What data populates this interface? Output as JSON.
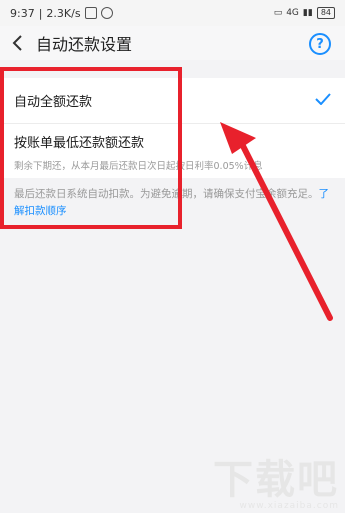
{
  "status_bar": {
    "time": "9:37",
    "speed": "2.3K/s",
    "signal_text": "4G",
    "battery": "84"
  },
  "header": {
    "title": "自动还款设置",
    "help_label": "?"
  },
  "options": [
    {
      "label": "自动全额还款",
      "selected": true
    },
    {
      "label": "按账单最低还款额还款",
      "subtitle": "剩余下期还，从本月最后还款日次日起按日利率0.05%计息",
      "selected": false
    }
  ],
  "note": {
    "text": "最后还款日系统自动扣款。为避免逾期，请确保支付宝余额充足。",
    "link": "了解扣款顺序"
  },
  "colors": {
    "accent": "#1a8fff",
    "highlight": "#e8212c"
  },
  "watermark": {
    "big": "下载吧",
    "small": "www.xiazaiba.com"
  }
}
